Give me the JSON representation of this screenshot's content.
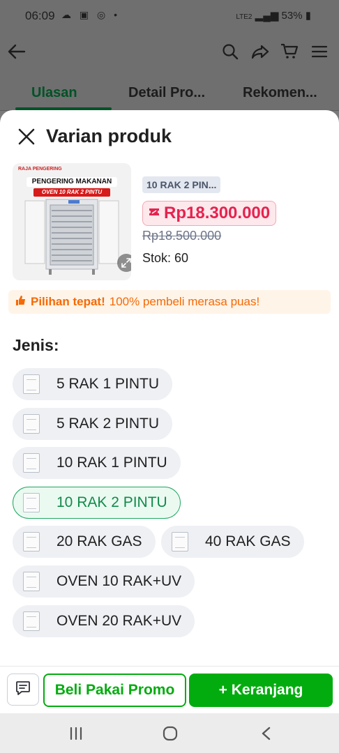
{
  "status_bar": {
    "time": "06:09",
    "battery": "53%",
    "network": "LTE2"
  },
  "tabs": [
    "Ulasan",
    "Detail Pro...",
    "Rekomen..."
  ],
  "sheet": {
    "title": "Varian produk"
  },
  "product": {
    "image_title": "PENGERING MAKANAN",
    "image_subtitle": "OVEN 10 RAK 2 PINTU",
    "image_brand": "RAJA PENGERING",
    "selected_variant": "10 RAK 2 PIN...",
    "price": "Rp18.300.000",
    "original_price": "Rp18.500.000",
    "stock": "Stok: 60"
  },
  "promo": {
    "bold": "Pilihan tepat!",
    "text": "100% pembeli merasa puas!"
  },
  "jenis_label": "Jenis:",
  "variants": [
    {
      "label": "5 RAK 1 PINTU",
      "selected": false
    },
    {
      "label": "5 RAK 2 PINTU",
      "selected": false
    },
    {
      "label": "10 RAK 1 PINTU",
      "selected": false
    },
    {
      "label": "10 RAK 2 PINTU",
      "selected": true
    },
    {
      "label": "20 RAK GAS",
      "selected": false
    },
    {
      "label": "40 RAK GAS",
      "selected": false
    },
    {
      "label": "OVEN 10 RAK+UV",
      "selected": false
    },
    {
      "label": "OVEN 20 RAK+UV",
      "selected": false
    }
  ],
  "actions": {
    "promo_button": "Beli Pakai Promo",
    "cart_button": "+ Keranjang"
  },
  "colors": {
    "primary_green": "#03ac0e",
    "price_red": "#e5234f",
    "promo_orange": "#f46a06"
  }
}
